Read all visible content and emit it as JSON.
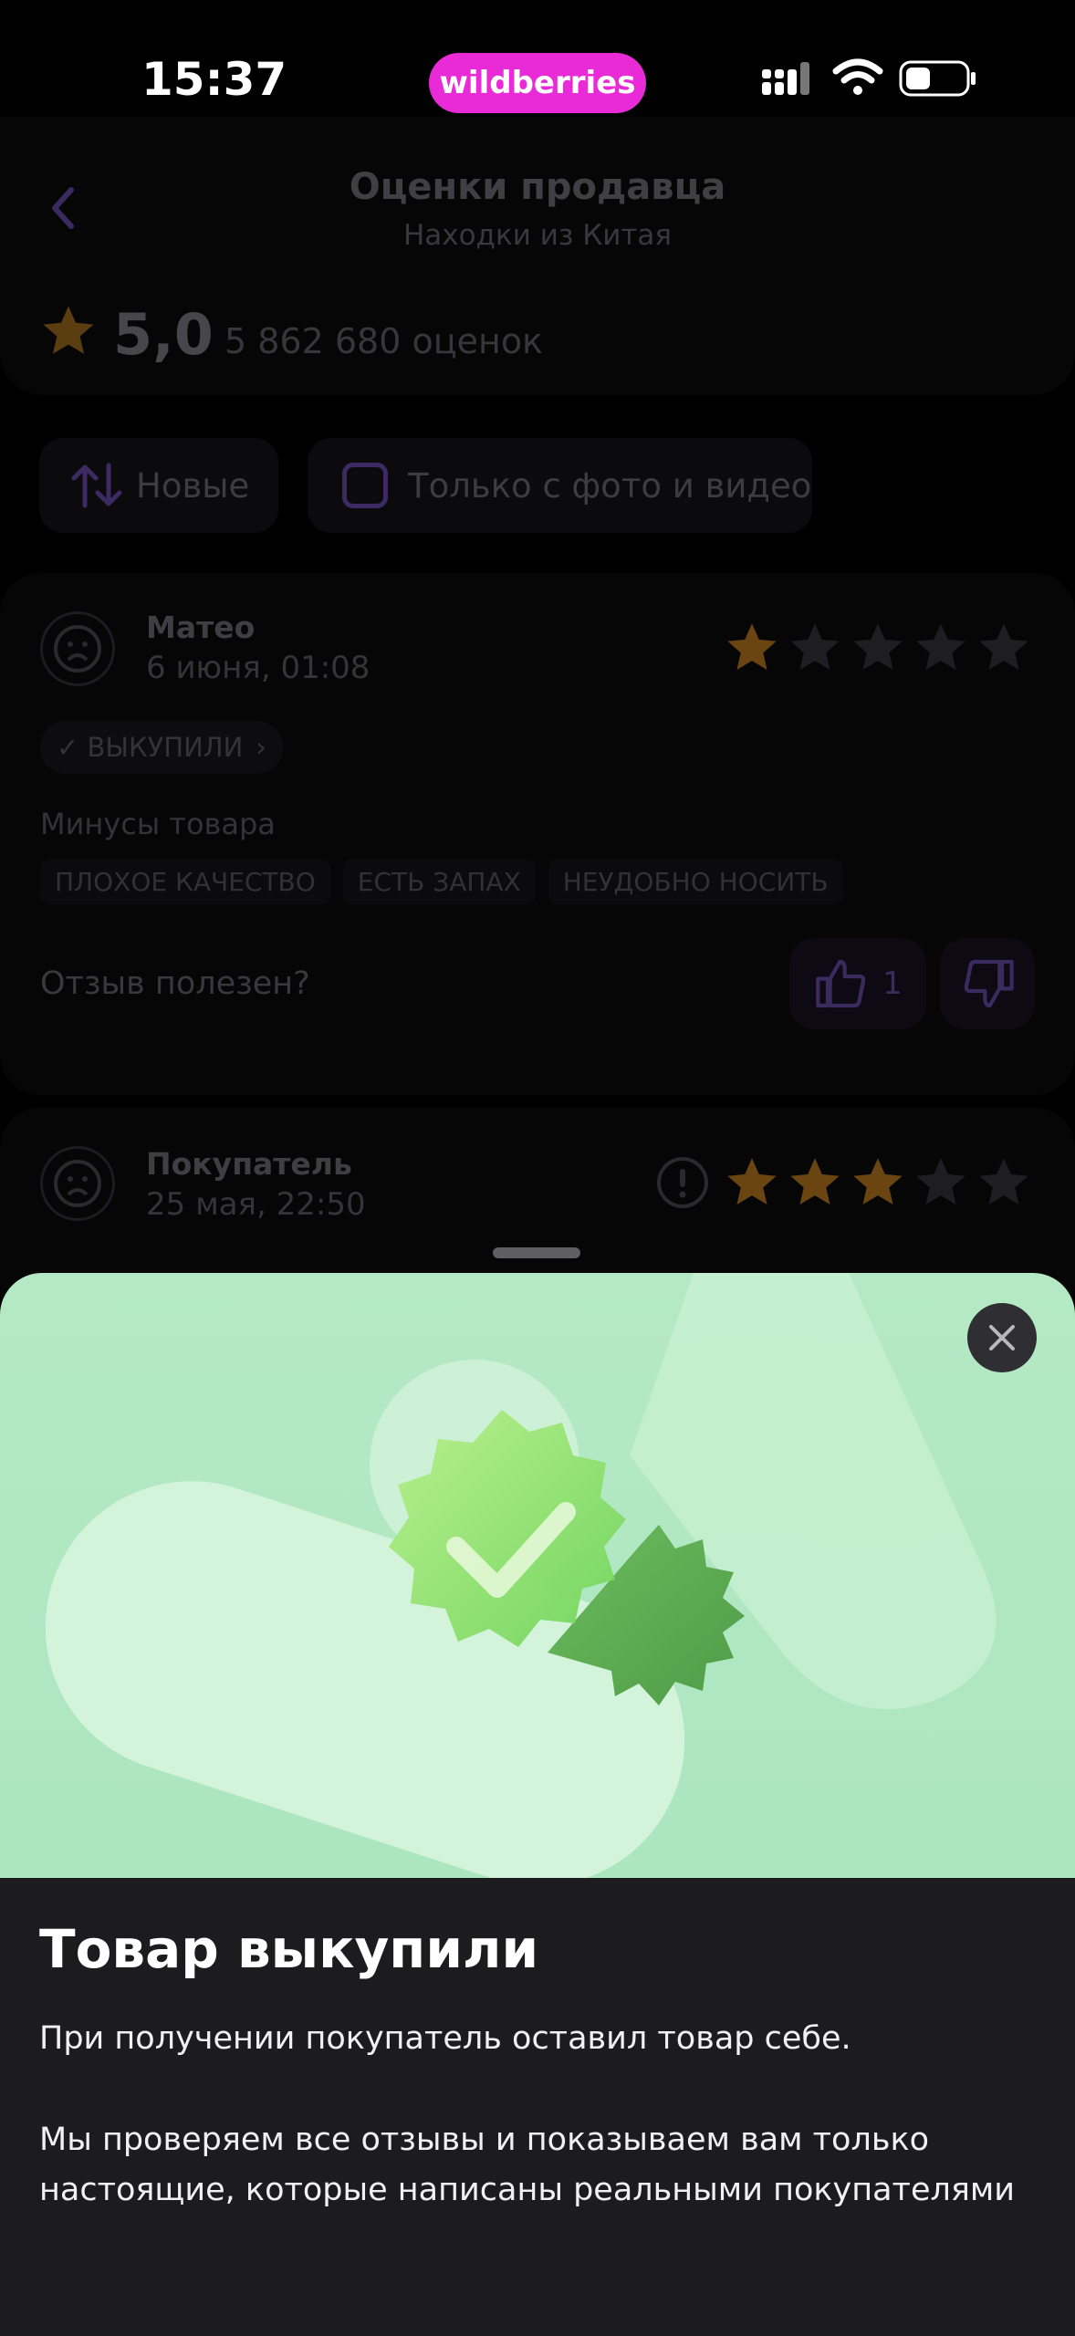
{
  "status_bar": {
    "time": "15:37",
    "brand": "wildberries"
  },
  "header": {
    "title": "Оценки продавца",
    "subtitle": "Находки из Китая",
    "rating": "5,0",
    "rating_count": "5 862 680 оценок"
  },
  "filters": {
    "sort_label": "Новые",
    "photo_label": "Только с фото и видео"
  },
  "reviews": [
    {
      "author": "Матео",
      "date": "6 июня, 01:08",
      "stars": 1,
      "badge": "✓ ВЫКУПИЛИ",
      "cons_title": "Минусы товара",
      "tags": [
        "ПЛОХОЕ КАЧЕСТВО",
        "ЕСТЬ ЗАПАХ",
        "НЕУДОБНО НОСИТЬ"
      ],
      "helpful_label": "Отзыв полезен?",
      "likes": "1"
    },
    {
      "author": "Покупатель",
      "date": "25 мая, 22:50",
      "stars": 3
    }
  ],
  "sheet": {
    "title": "Товар выкупили",
    "text1": "При получении покупатель оставил товар себе.",
    "text2": "Мы проверяем все отзывы и показываем вам только настоящие, которые написаны реальными покупателями"
  },
  "colors": {
    "brand": "#e92bd7",
    "accent_purple": "#6b3fb8",
    "star_gold": "#f5a623",
    "sheet_green": "#abe6bf"
  }
}
